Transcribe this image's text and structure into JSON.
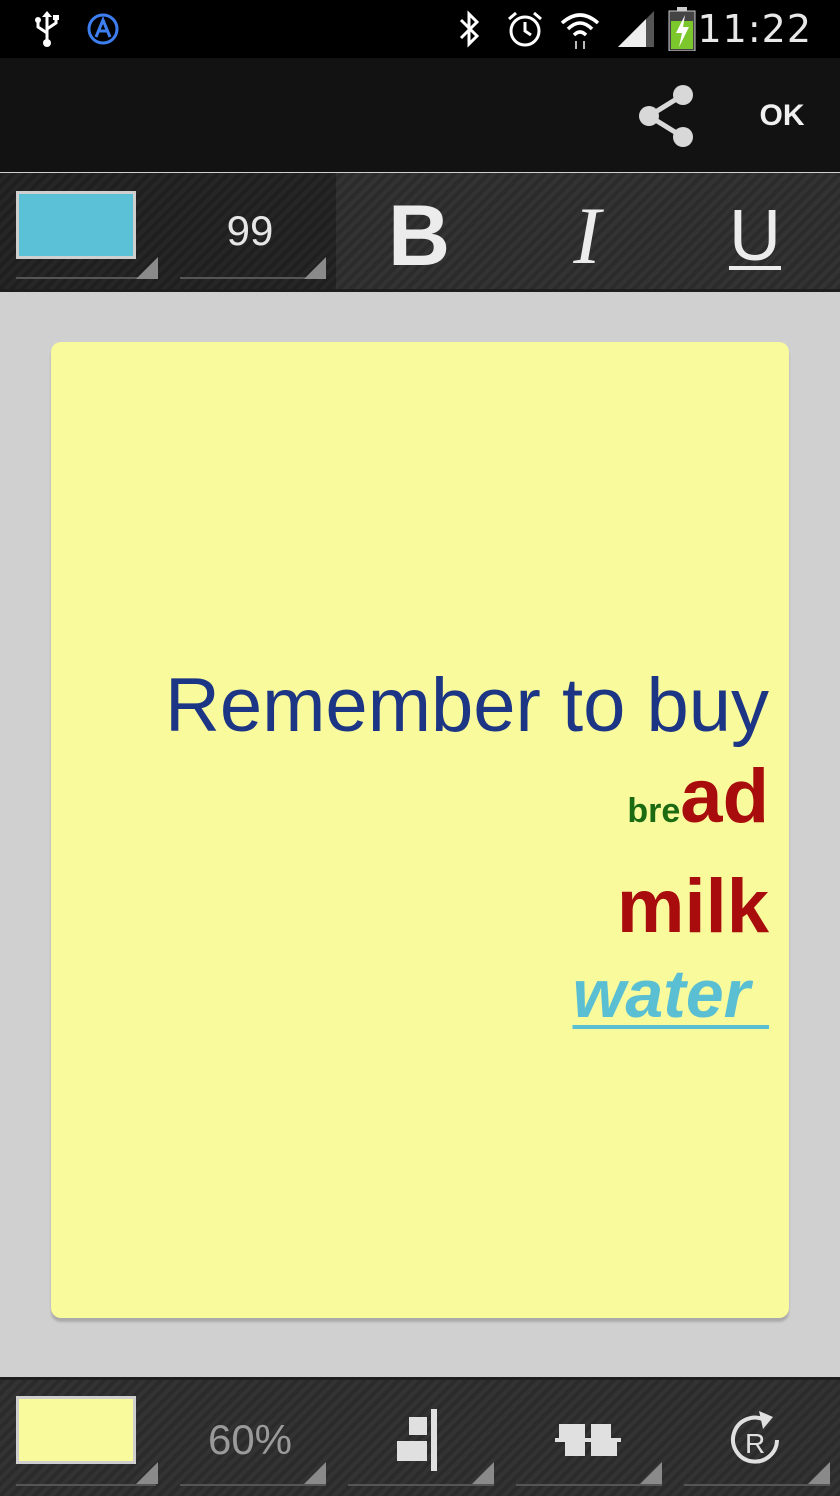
{
  "status_bar": {
    "time": "11:22",
    "icons": [
      "usb-icon",
      "autosync-icon",
      "bluetooth-icon",
      "alarm-icon",
      "wifi-icon",
      "signal-icon",
      "battery-charging-icon"
    ]
  },
  "action_bar": {
    "share_icon": "share-icon",
    "ok_label": "OK"
  },
  "text_toolbar": {
    "text_color": "#5bc1d6",
    "font_size": "99",
    "bold_label": "B",
    "italic_label": "I",
    "underline_label": "U"
  },
  "note": {
    "background_color": "#f9fa9c",
    "line1": "Remember to buy",
    "line2_small": "bre",
    "line2_large": "ad",
    "line3": "milk",
    "line4": "water "
  },
  "bottom_toolbar": {
    "note_color": "#f9fa9c",
    "opacity": "60%",
    "align_icon": "align-right-icon",
    "valign_icon": "align-center-icon",
    "rotate_icon": "rotate-icon"
  }
}
